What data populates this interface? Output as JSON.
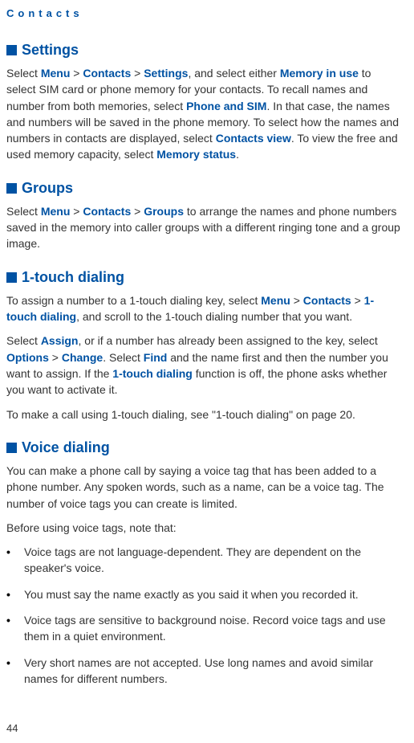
{
  "header": "Contacts",
  "pageNumber": "44",
  "sections": {
    "settings": {
      "title": "Settings",
      "p1a": "Select ",
      "menu": "Menu",
      "gt": " > ",
      "contacts": "Contacts",
      "settingsLink": "Settings",
      "p1b": ", and select either ",
      "memInUse": "Memory in use",
      "p1c": " to select SIM card or phone memory for your contacts. To recall names and number from both memories, select ",
      "phoneSim": "Phone and SIM",
      "p1d": ". In that case, the names and numbers will be saved in the phone memory. To select how the names and numbers in contacts are displayed, select ",
      "contactsView": "Contacts view",
      "p1e": ". To view the free and used memory capacity, select ",
      "memStatus": "Memory status",
      "p1f": "."
    },
    "groups": {
      "title": "Groups",
      "p1a": "Select ",
      "menu": "Menu",
      "gt": " > ",
      "contacts": "Contacts",
      "groupsLink": "Groups",
      "p1b": " to arrange the names and phone numbers saved in the memory into caller groups with a different ringing tone and a group image."
    },
    "oneTouch": {
      "title": "1-touch dialing",
      "p1a": "To assign a number to a 1-touch dialing key, select ",
      "menu": "Menu",
      "gt": " > ",
      "contacts": "Contacts",
      "oneTouchLink": "1-touch dialing",
      "p1b": ", and scroll to the 1-touch dialing number that you want.",
      "p2a": "Select ",
      "assign": "Assign",
      "p2b": ", or if a number has already been assigned to the key, select ",
      "options": "Options",
      "change": "Change",
      "p2c": ". Select ",
      "find": "Find",
      "p2d": " and the name first and then the number you want to assign. If the ",
      "oneTouchFn": "1-touch dialing",
      "p2e": " function is off, the phone asks whether you want to activate it.",
      "p3": "To make a call using 1-touch dialing, see \"1-touch dialing\" on page 20."
    },
    "voice": {
      "title": "Voice dialing",
      "p1": "You can make a phone call by saying a voice tag that has been added to a phone number. Any spoken words, such as a name, can be a voice tag. The number of voice tags you can create is limited.",
      "p2": "Before using voice tags, note that:",
      "bullets": [
        "Voice tags are not language-dependent. They are dependent on the speaker's voice.",
        "You must say the name exactly as you said it when you recorded it.",
        "Voice tags are sensitive to background noise. Record voice tags and use them in a quiet environment.",
        "Very short names are not accepted. Use long names and avoid similar names for different numbers."
      ]
    }
  }
}
